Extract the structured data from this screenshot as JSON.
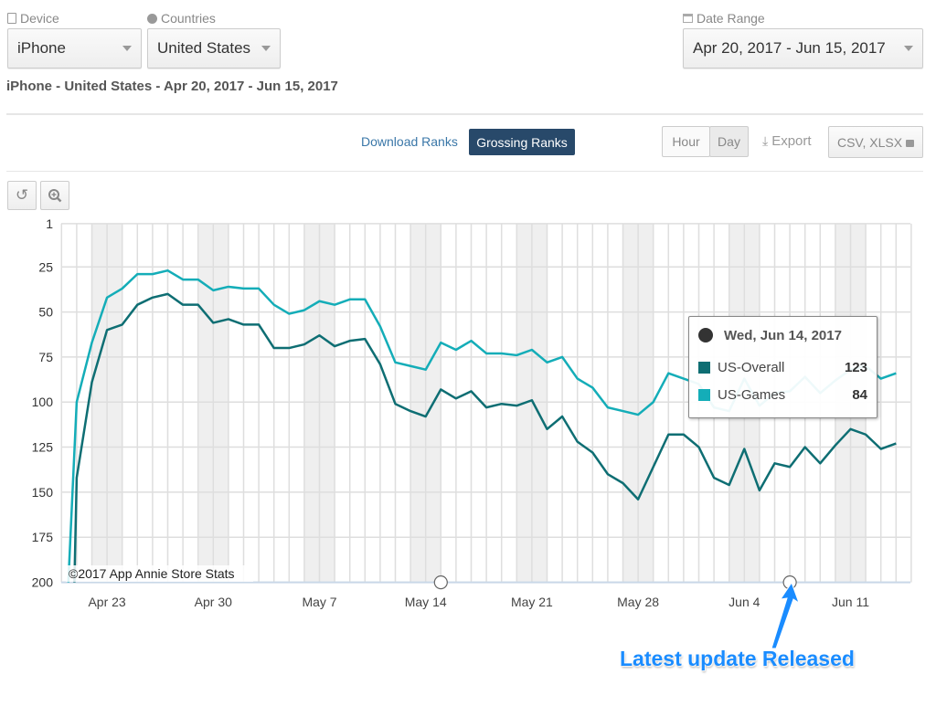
{
  "filters": {
    "device": {
      "label": "Device",
      "icon": "mobile-icon",
      "value": "iPhone"
    },
    "countries": {
      "label": "Countries",
      "icon": "globe-icon",
      "value": "United States"
    },
    "date_range": {
      "label": "Date Range",
      "icon": "calendar-icon",
      "value": "Apr 20, 2017 - Jun 15, 2017"
    }
  },
  "subtitle": "iPhone - United States - Apr 20, 2017 - Jun 15, 2017",
  "toolbar": {
    "download_ranks": "Download Ranks",
    "grossing_ranks": "Grossing Ranks",
    "hour": "Hour",
    "day": "Day",
    "export": "Export",
    "formats": "CSV, XLSX"
  },
  "colors": {
    "overall": "#0e6e73",
    "games": "#14adb8",
    "accent": "#28496a",
    "annotation": "#1a8cff"
  },
  "tooltip": {
    "date": "Wed, Jun 14, 2017",
    "rows": [
      {
        "name": "US-Overall",
        "value": "123"
      },
      {
        "name": "US-Games",
        "value": "84"
      }
    ]
  },
  "annotation": "Latest update Released",
  "chart_data": {
    "type": "line",
    "credit": "©2017 App Annie Store Stats",
    "x_start": "2017-04-20",
    "x_end": "2017-06-14",
    "x_tick_labels": [
      "Apr 23",
      "Apr 30",
      "May 7",
      "May 14",
      "May 21",
      "May 28",
      "Jun 4",
      "Jun 11"
    ],
    "x_tick_dates": [
      "2017-04-23",
      "2017-04-30",
      "2017-05-07",
      "2017-05-14",
      "2017-05-21",
      "2017-05-28",
      "2017-06-04",
      "2017-06-11"
    ],
    "y_ticks": [
      1,
      25,
      50,
      75,
      100,
      125,
      150,
      175,
      200
    ],
    "ylim": [
      1,
      200
    ],
    "y_reversed": true,
    "grid": true,
    "weekend_shading": true,
    "event_markers": [
      "2017-05-15",
      "2017-06-07"
    ],
    "series": [
      {
        "name": "US-Overall",
        "color": "#0e6e73",
        "values": [
          null,
          142,
          89,
          60,
          57,
          46,
          42,
          40,
          46,
          46,
          56,
          54,
          57,
          57,
          70,
          70,
          68,
          63,
          69,
          66,
          65,
          79,
          101,
          105,
          108,
          93,
          98,
          94,
          103,
          101,
          102,
          99,
          115,
          108,
          122,
          128,
          140,
          145,
          154,
          136,
          118,
          118,
          125,
          142,
          146,
          126,
          149,
          134,
          136,
          125,
          134,
          124,
          115,
          118,
          126,
          123
        ]
      },
      {
        "name": "US-Games",
        "color": "#14adb8",
        "values": [
          null,
          100,
          67,
          42,
          37,
          29,
          29,
          27,
          32,
          32,
          38,
          36,
          37,
          37,
          46,
          51,
          49,
          44,
          46,
          43,
          43,
          58,
          78,
          80,
          82,
          67,
          71,
          66,
          73,
          73,
          74,
          71,
          78,
          75,
          87,
          92,
          103,
          105,
          107,
          100,
          84,
          87,
          90,
          103,
          105,
          87,
          102,
          95,
          94,
          86,
          95,
          88,
          82,
          80,
          87,
          84
        ]
      }
    ]
  }
}
